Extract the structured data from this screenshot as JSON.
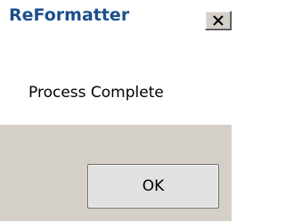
{
  "window": {
    "title": "ReFormatter"
  },
  "dialog": {
    "message": "Process Complete",
    "ok_label": "OK"
  },
  "icons": {
    "close": "close-icon"
  },
  "colors": {
    "title_text": "#1c4f8c",
    "footer_bg": "#d4d0c8",
    "content_bg": "#ffffff"
  }
}
